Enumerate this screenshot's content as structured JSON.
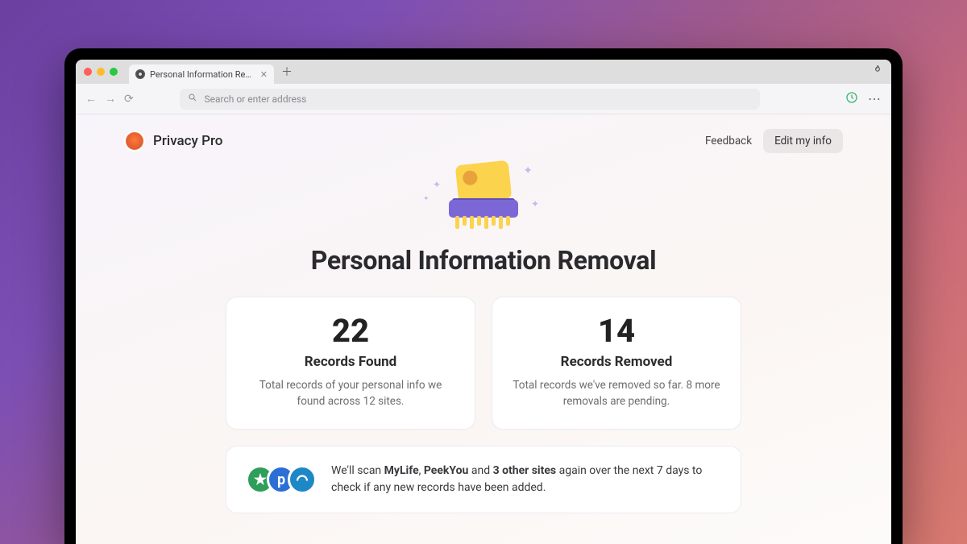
{
  "browser": {
    "tab_title": "Personal Information Removal",
    "address_placeholder": "Search or enter address"
  },
  "header": {
    "brand": "Privacy Pro",
    "feedback": "Feedback",
    "edit": "Edit my info"
  },
  "hero": {
    "title": "Personal Information Removal"
  },
  "stats": {
    "found": {
      "value": "22",
      "label": "Records Found",
      "desc": "Total records of your personal info we found across 12 sites."
    },
    "removed": {
      "value": "14",
      "label": "Records Removed",
      "desc": "Total records we've removed so far. 8 more removals are pending."
    }
  },
  "scan": {
    "site1": "MyLife",
    "site2": "PeekYou",
    "others": "3 other sites",
    "prefix": "We'll scan ",
    "middle": " and ",
    "suffix": " again over the next 7 days to check if any new records have been added."
  }
}
